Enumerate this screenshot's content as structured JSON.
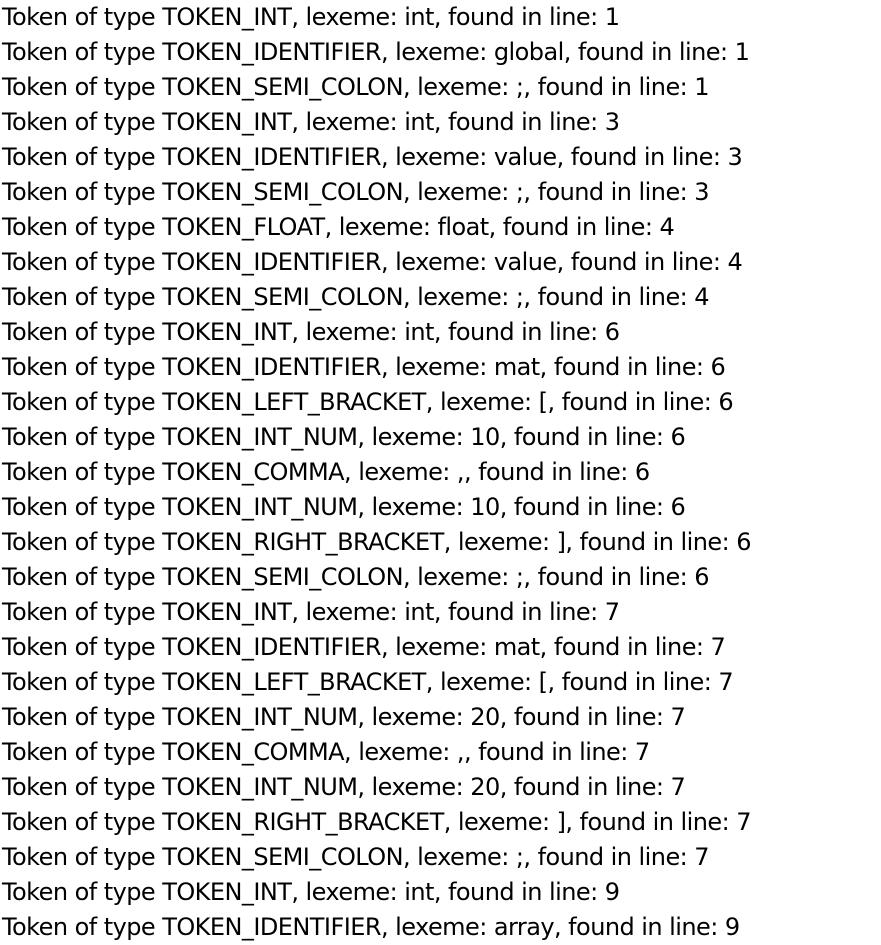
{
  "lines": [
    "Token of type TOKEN_INT, lexeme: int, found in line: 1",
    "Token of type TOKEN_IDENTIFIER, lexeme: global, found in line: 1",
    "Token of type TOKEN_SEMI_COLON, lexeme: ;, found in line: 1",
    "Token of type TOKEN_INT, lexeme: int, found in line: 3",
    "Token of type TOKEN_IDENTIFIER, lexeme: value, found in line: 3",
    "Token of type TOKEN_SEMI_COLON, lexeme: ;, found in line: 3",
    "Token of type TOKEN_FLOAT, lexeme: float, found in line: 4",
    "Token of type TOKEN_IDENTIFIER, lexeme: value, found in line: 4",
    "Token of type TOKEN_SEMI_COLON, lexeme: ;, found in line: 4",
    "Token of type TOKEN_INT, lexeme: int, found in line: 6",
    "Token of type TOKEN_IDENTIFIER, lexeme: mat, found in line: 6",
    "Token of type TOKEN_LEFT_BRACKET, lexeme: [, found in line: 6",
    "Token of type TOKEN_INT_NUM, lexeme: 10, found in line: 6",
    "Token of type TOKEN_COMMA, lexeme: ,, found in line: 6",
    "Token of type TOKEN_INT_NUM, lexeme: 10, found in line: 6",
    "Token of type TOKEN_RIGHT_BRACKET, lexeme: ], found in line: 6",
    "Token of type TOKEN_SEMI_COLON, lexeme: ;, found in line: 6",
    "Token of type TOKEN_INT, lexeme: int, found in line: 7",
    "Token of type TOKEN_IDENTIFIER, lexeme: mat, found in line: 7",
    "Token of type TOKEN_LEFT_BRACKET, lexeme: [, found in line: 7",
    "Token of type TOKEN_INT_NUM, lexeme: 20, found in line: 7",
    "Token of type TOKEN_COMMA, lexeme: ,, found in line: 7",
    "Token of type TOKEN_INT_NUM, lexeme: 20, found in line: 7",
    "Token of type TOKEN_RIGHT_BRACKET, lexeme: ], found in line: 7",
    "Token of type TOKEN_SEMI_COLON, lexeme: ;, found in line: 7",
    "Token of type TOKEN_INT, lexeme: int, found in line: 9",
    "Token of type TOKEN_IDENTIFIER, lexeme: array, found in line: 9"
  ]
}
